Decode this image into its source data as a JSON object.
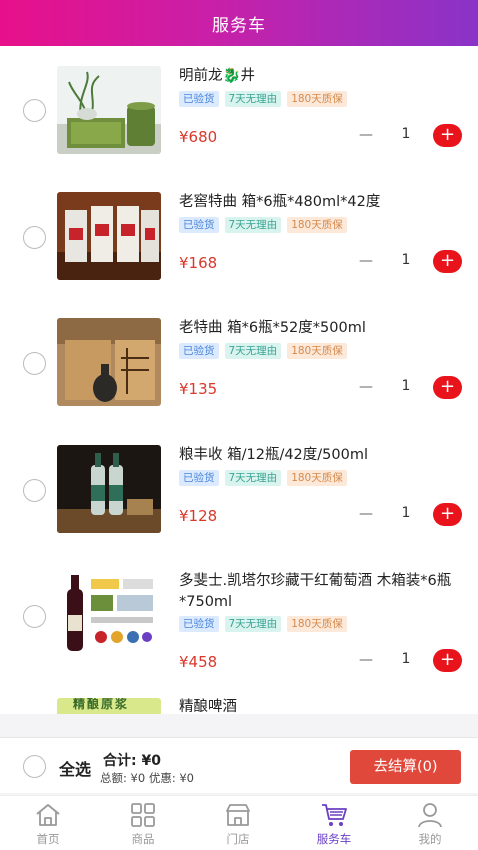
{
  "header": {
    "title": "服务车"
  },
  "items": [
    {
      "name": "明前龙🐉井",
      "tags": [
        "已验货",
        "7天无理由",
        "180天质保"
      ],
      "price": "¥680",
      "qty": "1",
      "minus": "—",
      "plus": "+"
    },
    {
      "name": "老窖特曲 箱*6瓶*480ml*42度",
      "tags": [
        "已验货",
        "7天无理由",
        "180天质保"
      ],
      "price": "¥168",
      "qty": "1",
      "minus": "—",
      "plus": "+"
    },
    {
      "name": "老特曲 箱*6瓶*52度*500ml",
      "tags": [
        "已验货",
        "7天无理由",
        "180天质保"
      ],
      "price": "¥135",
      "qty": "1",
      "minus": "—",
      "plus": "+"
    },
    {
      "name": "粮丰收 箱/12瓶/42度/500ml",
      "tags": [
        "已验货",
        "7天无理由",
        "180天质保"
      ],
      "price": "¥128",
      "qty": "1",
      "minus": "—",
      "plus": "+"
    },
    {
      "name": "多斐士.凯塔尔珍藏干红葡萄酒 木箱装*6瓶*750ml",
      "tags": [
        "已验货",
        "7天无理由",
        "180天质保"
      ],
      "price": "¥458",
      "qty": "1",
      "minus": "—",
      "plus": "+"
    },
    {
      "name": "精酿啤酒",
      "thumb_text": "精酿原浆"
    }
  ],
  "summary": {
    "select_all": "全选",
    "total": "合计: ¥0",
    "sub": "总额: ¥0 优惠: ¥0",
    "checkout": "去结算(0)"
  },
  "tabs": [
    {
      "label": "首页",
      "icon": "home-icon"
    },
    {
      "label": "商品",
      "icon": "grid-icon"
    },
    {
      "label": "门店",
      "icon": "store-icon"
    },
    {
      "label": "服务车",
      "icon": "cart-icon",
      "active": true
    },
    {
      "label": "我的",
      "icon": "user-icon"
    }
  ],
  "colors": {
    "header_start": "#e8108a",
    "header_end": "#8a33c8",
    "price": "#d9382b",
    "plus_button": "#e8131b",
    "checkout": "#e0483b",
    "active_tab": "#6b3fc4"
  }
}
